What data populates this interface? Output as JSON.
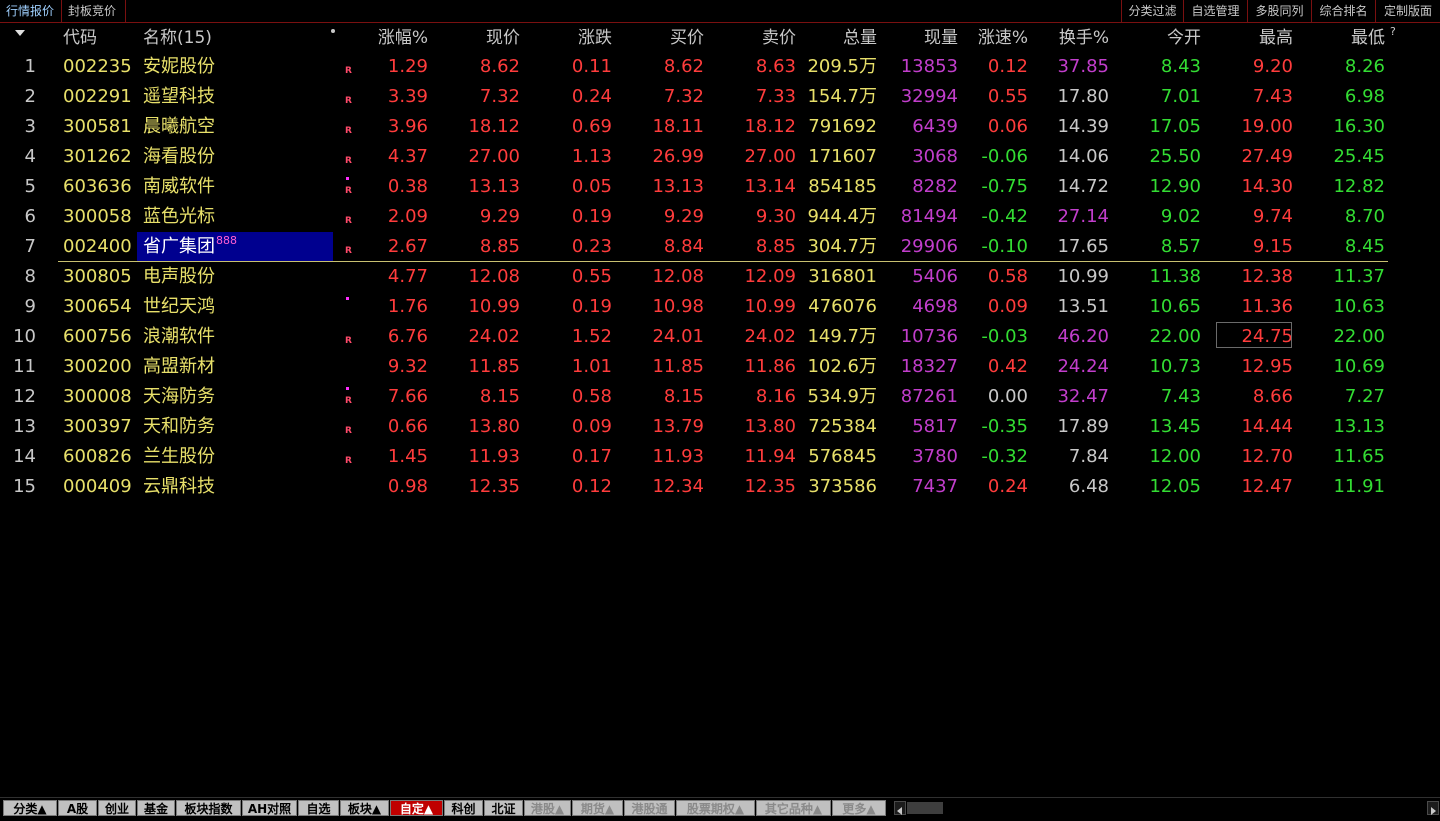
{
  "top_tabs": [
    "行情报价",
    "封板竞价"
  ],
  "top_right_buttons": [
    "分类过滤",
    "自选管理",
    "多股同列",
    "综合排名",
    "定制版面"
  ],
  "header": {
    "code": "代码",
    "name": "名称(15)",
    "pct": "涨幅%",
    "price": "现价",
    "change": "涨跌",
    "bid": "买价",
    "ask": "卖价",
    "volume": "总量",
    "cur_vol": "现量",
    "speed": "涨速%",
    "turnover": "换手%",
    "open": "今开",
    "high": "最高",
    "low": "最低",
    "help": "?"
  },
  "rows": [
    {
      "idx": "1",
      "code": "002235",
      "name": "安妮股份",
      "flag": "R",
      "dot": false,
      "pct": "1.29",
      "price": "8.62",
      "change": "0.11",
      "bid": "8.62",
      "ask": "8.63",
      "volume": "209.5万",
      "cur_vol": "13853",
      "speed": "0.12",
      "turnover": "37.85",
      "open": "8.43",
      "high": "9.20",
      "low": "8.26"
    },
    {
      "idx": "2",
      "code": "002291",
      "name": "遥望科技",
      "flag": "R",
      "dot": false,
      "pct": "3.39",
      "price": "7.32",
      "change": "0.24",
      "bid": "7.32",
      "ask": "7.33",
      "volume": "154.7万",
      "cur_vol": "32994",
      "speed": "0.55",
      "turnover": "17.80",
      "open": "7.01",
      "high": "7.43",
      "low": "6.98"
    },
    {
      "idx": "3",
      "code": "300581",
      "name": "晨曦航空",
      "flag": "R",
      "dot": false,
      "pct": "3.96",
      "price": "18.12",
      "change": "0.69",
      "bid": "18.11",
      "ask": "18.12",
      "volume": "791692",
      "cur_vol": "6439",
      "speed": "0.06",
      "turnover": "14.39",
      "open": "17.05",
      "high": "19.00",
      "low": "16.30"
    },
    {
      "idx": "4",
      "code": "301262",
      "name": "海看股份",
      "flag": "R",
      "dot": false,
      "pct": "4.37",
      "price": "27.00",
      "change": "1.13",
      "bid": "26.99",
      "ask": "27.00",
      "volume": "171607",
      "cur_vol": "3068",
      "speed": "-0.06",
      "turnover": "14.06",
      "open": "25.50",
      "high": "27.49",
      "low": "25.45"
    },
    {
      "idx": "5",
      "code": "603636",
      "name": "南威软件",
      "flag": "R",
      "dot": true,
      "pct": "0.38",
      "price": "13.13",
      "change": "0.05",
      "bid": "13.13",
      "ask": "13.14",
      "volume": "854185",
      "cur_vol": "8282",
      "speed": "-0.75",
      "turnover": "14.72",
      "open": "12.90",
      "high": "14.30",
      "low": "12.82"
    },
    {
      "idx": "6",
      "code": "300058",
      "name": "蓝色光标",
      "flag": "R",
      "dot": false,
      "pct": "2.09",
      "price": "9.29",
      "change": "0.19",
      "bid": "9.29",
      "ask": "9.30",
      "volume": "944.4万",
      "cur_vol": "81494",
      "speed": "-0.42",
      "turnover": "27.14",
      "open": "9.02",
      "high": "9.74",
      "low": "8.70"
    },
    {
      "idx": "7",
      "code": "002400",
      "name": "省广集团",
      "badge": "888",
      "flag": "R",
      "dot": false,
      "pct": "2.67",
      "price": "8.85",
      "change": "0.23",
      "bid": "8.84",
      "ask": "8.85",
      "volume": "304.7万",
      "cur_vol": "29906",
      "speed": "-0.10",
      "turnover": "17.65",
      "open": "8.57",
      "high": "9.15",
      "low": "8.45"
    },
    {
      "idx": "8",
      "code": "300805",
      "name": "电声股份",
      "flag": "",
      "dot": false,
      "pct": "4.77",
      "price": "12.08",
      "change": "0.55",
      "bid": "12.08",
      "ask": "12.09",
      "volume": "316801",
      "cur_vol": "5406",
      "speed": "0.58",
      "turnover": "10.99",
      "open": "11.38",
      "high": "12.38",
      "low": "11.37"
    },
    {
      "idx": "9",
      "code": "300654",
      "name": "世纪天鸿",
      "flag": "",
      "dot": true,
      "pct": "1.76",
      "price": "10.99",
      "change": "0.19",
      "bid": "10.98",
      "ask": "10.99",
      "volume": "476076",
      "cur_vol": "4698",
      "speed": "0.09",
      "turnover": "13.51",
      "open": "10.65",
      "high": "11.36",
      "low": "10.63"
    },
    {
      "idx": "10",
      "code": "600756",
      "name": "浪潮软件",
      "flag": "R",
      "dot": false,
      "pct": "6.76",
      "price": "24.02",
      "change": "1.52",
      "bid": "24.01",
      "ask": "24.02",
      "volume": "149.7万",
      "cur_vol": "10736",
      "speed": "-0.03",
      "turnover": "46.20",
      "open": "22.00",
      "high": "24.75",
      "low": "22.00"
    },
    {
      "idx": "11",
      "code": "300200",
      "name": "高盟新材",
      "flag": "",
      "dot": false,
      "pct": "9.32",
      "price": "11.85",
      "change": "1.01",
      "bid": "11.85",
      "ask": "11.86",
      "volume": "102.6万",
      "cur_vol": "18327",
      "speed": "0.42",
      "turnover": "24.24",
      "open": "10.73",
      "high": "12.95",
      "low": "10.69"
    },
    {
      "idx": "12",
      "code": "300008",
      "name": "天海防务",
      "flag": "R",
      "dot": true,
      "pct": "7.66",
      "price": "8.15",
      "change": "0.58",
      "bid": "8.15",
      "ask": "8.16",
      "volume": "534.9万",
      "cur_vol": "87261",
      "speed": "0.00",
      "turnover": "32.47",
      "open": "7.43",
      "high": "8.66",
      "low": "7.27"
    },
    {
      "idx": "13",
      "code": "300397",
      "name": "天和防务",
      "flag": "R",
      "dot": false,
      "pct": "0.66",
      "price": "13.80",
      "change": "0.09",
      "bid": "13.79",
      "ask": "13.80",
      "volume": "725384",
      "cur_vol": "5817",
      "speed": "-0.35",
      "turnover": "17.89",
      "open": "13.45",
      "high": "14.44",
      "low": "13.13"
    },
    {
      "idx": "14",
      "code": "600826",
      "name": "兰生股份",
      "flag": "R",
      "dot": false,
      "pct": "1.45",
      "price": "11.93",
      "change": "0.17",
      "bid": "11.93",
      "ask": "11.94",
      "volume": "576845",
      "cur_vol": "3780",
      "speed": "-0.32",
      "turnover": "7.84",
      "open": "12.00",
      "high": "12.70",
      "low": "11.65"
    },
    {
      "idx": "15",
      "code": "000409",
      "name": "云鼎科技",
      "flag": "",
      "dot": false,
      "pct": "0.98",
      "price": "12.35",
      "change": "0.12",
      "bid": "12.34",
      "ask": "12.35",
      "volume": "373586",
      "cur_vol": "7437",
      "speed": "0.24",
      "turnover": "6.48",
      "open": "12.05",
      "high": "12.47",
      "low": "11.91"
    }
  ],
  "bottom_tabs": [
    "分类▲",
    "A股",
    "创业",
    "基金",
    "板块指数",
    "AH对照",
    "自选",
    "板块▲",
    "自定▲",
    "科创",
    "北证",
    "港股▲",
    "期货▲",
    "港股通",
    "股票期权▲",
    "其它品种▲",
    "更多▲"
  ],
  "active_bottom_tab": "自定▲",
  "colors": {
    "up": "#ff3c3c",
    "down": "#33dd33",
    "code": "#e8e06a",
    "volume_now": "#c23ecc",
    "selection": "#00008f",
    "active_tab": "#c00000"
  }
}
